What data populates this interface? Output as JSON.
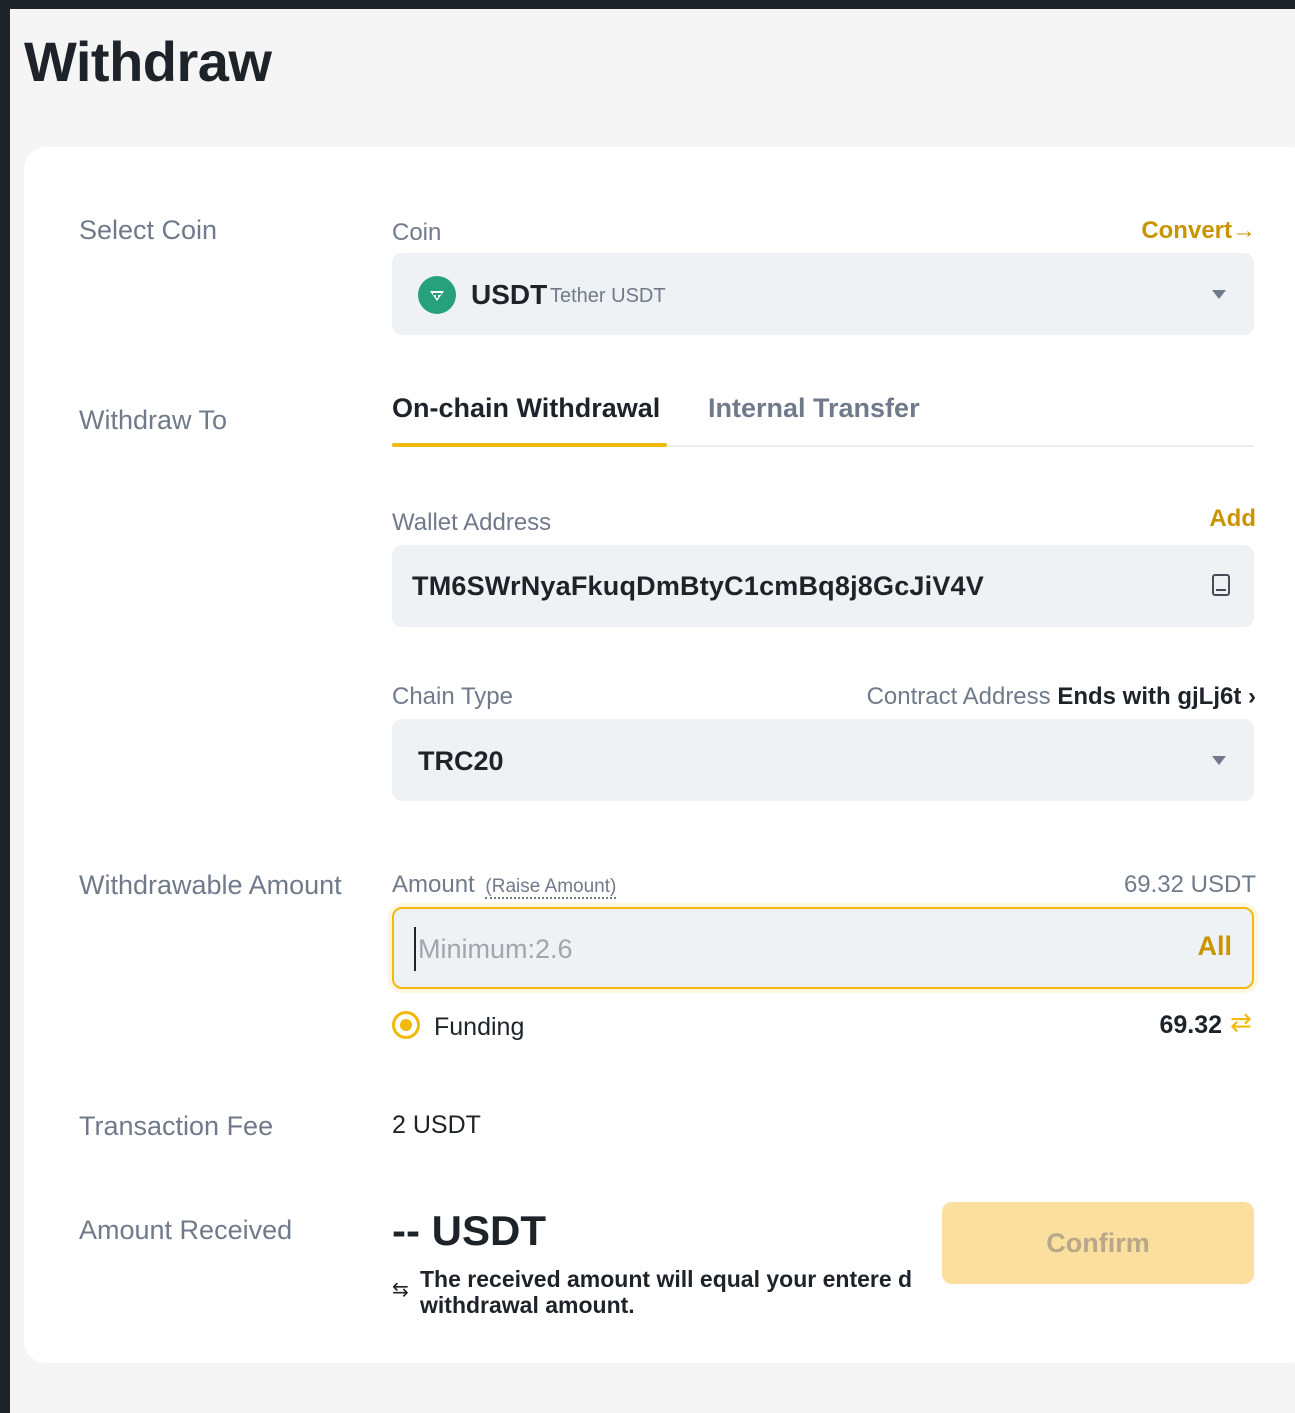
{
  "page": {
    "title": "Withdraw"
  },
  "select_coin": {
    "row_label": "Select Coin",
    "field_label": "Coin",
    "convert_label": "Convert→",
    "symbol": "USDT",
    "name": "Tether USDT"
  },
  "withdraw_to": {
    "row_label": "Withdraw To",
    "tabs": [
      {
        "label": "On-chain Withdrawal",
        "active": true
      },
      {
        "label": "Internal Transfer",
        "active": false
      }
    ],
    "wallet_label": "Wallet Address",
    "add_label": "Add",
    "wallet_address": "TM6SWrNyaFkuqDmBtyC1cmBq8j8GcJiV4V",
    "chain_label": "Chain Type",
    "contract_label": "Contract Address",
    "contract_ends": "Ends with gjLj6t",
    "chain_value": "TRC20"
  },
  "withdrawable": {
    "row_label": "Withdrawable Amount",
    "amount_label": "Amount",
    "raise_label": "(Raise Amount)",
    "available": "69.32 USDT",
    "placeholder": "Minimum:2.6",
    "all_label": "All",
    "account_label": "Funding",
    "account_balance": "69.32"
  },
  "fee": {
    "row_label": "Transaction Fee",
    "value": "2 USDT"
  },
  "received": {
    "row_label": "Amount Received",
    "value": "-- USDT",
    "note": "The received amount will equal your entere d withdrawal amount.",
    "confirm_label": "Confirm"
  },
  "colors": {
    "accent": "#f0b90b",
    "accent_text": "#c99400",
    "coin": "#26a17b"
  }
}
